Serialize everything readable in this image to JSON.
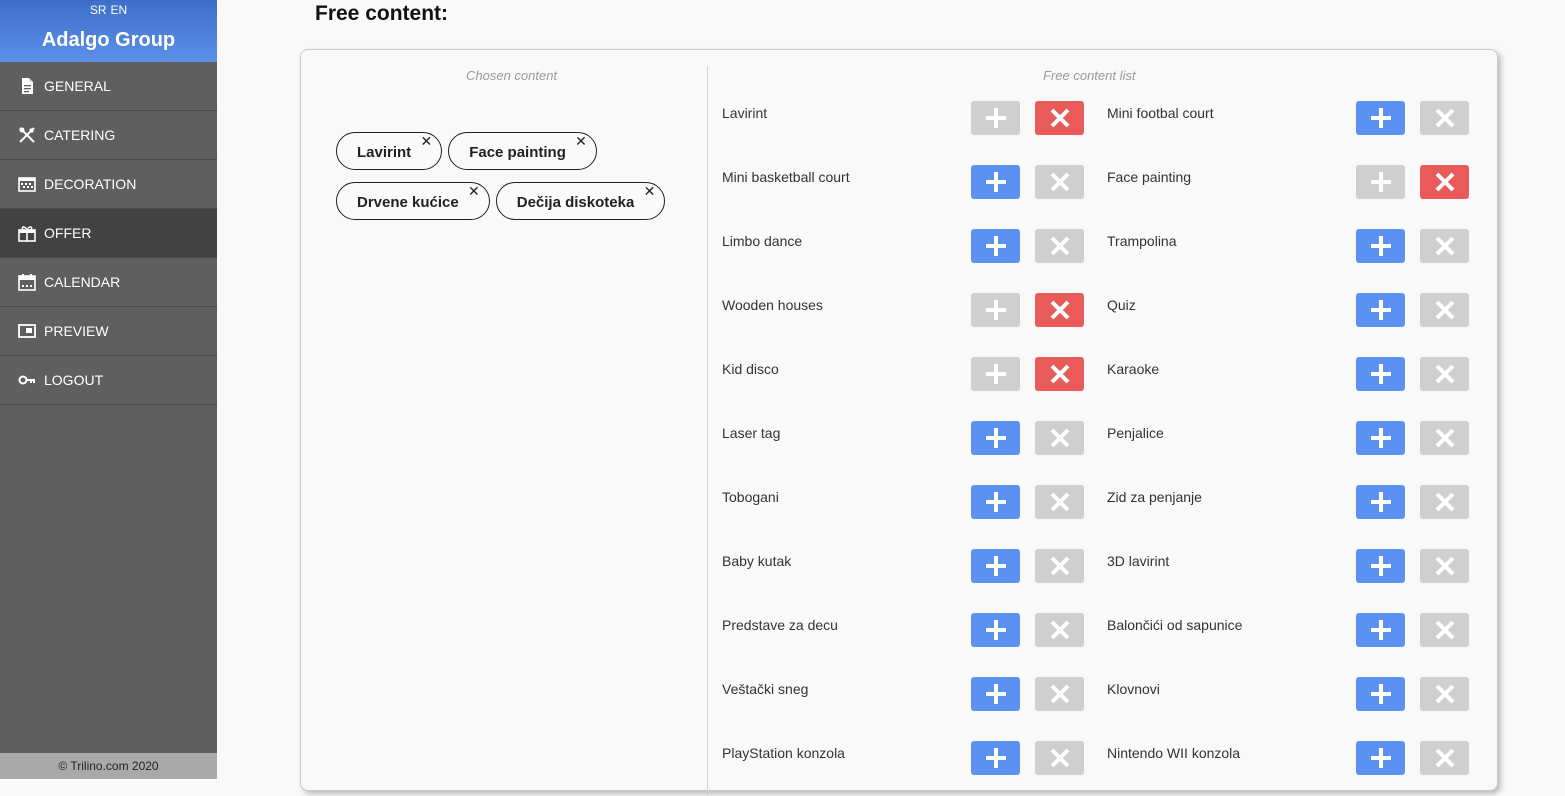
{
  "sidebar": {
    "lang": [
      "SR",
      "EN"
    ],
    "brand": "Adalgo Group",
    "items": [
      {
        "label": "GENERAL",
        "icon": "document-icon",
        "active": false
      },
      {
        "label": "CATERING",
        "icon": "fork-knife-icon",
        "active": false
      },
      {
        "label": "DECORATION",
        "icon": "grid-pattern-icon",
        "active": false
      },
      {
        "label": "OFFER",
        "icon": "gift-box-icon",
        "active": true
      },
      {
        "label": "CALENDAR",
        "icon": "calendar-icon",
        "active": false
      },
      {
        "label": "PREVIEW",
        "icon": "preview-window-icon",
        "active": false
      },
      {
        "label": "LOGOUT",
        "icon": "key-icon",
        "active": false
      }
    ],
    "footer": "© Trilino.com 2020"
  },
  "main": {
    "title": "Free content:",
    "chosen_title": "Chosen content",
    "free_title": "Free content list",
    "chosen": [
      "Lavirint",
      "Face painting",
      "Drvene kućice",
      "Dečija diskoteka"
    ],
    "left_list": [
      {
        "label": "Lavirint",
        "selected": true
      },
      {
        "label": "Mini basketball court",
        "selected": false
      },
      {
        "label": "Limbo dance",
        "selected": false
      },
      {
        "label": "Wooden houses",
        "selected": true
      },
      {
        "label": "Kid disco",
        "selected": true
      },
      {
        "label": "Laser tag",
        "selected": false
      },
      {
        "label": "Tobogani",
        "selected": false
      },
      {
        "label": "Baby kutak",
        "selected": false
      },
      {
        "label": "Predstave za decu",
        "selected": false
      },
      {
        "label": "Veštački sneg",
        "selected": false
      },
      {
        "label": "PlayStation konzola",
        "selected": false
      }
    ],
    "right_list": [
      {
        "label": "Mini footbal court",
        "selected": false
      },
      {
        "label": "Face painting",
        "selected": true
      },
      {
        "label": "Trampolina",
        "selected": false
      },
      {
        "label": "Quiz",
        "selected": false
      },
      {
        "label": "Karaoke",
        "selected": false
      },
      {
        "label": "Penjalice",
        "selected": false
      },
      {
        "label": "Zid za penjanje",
        "selected": false
      },
      {
        "label": "3D lavirint",
        "selected": false
      },
      {
        "label": "Balončići od sapunice",
        "selected": false
      },
      {
        "label": "Klovnovi",
        "selected": false
      },
      {
        "label": "Nintendo WII konzola",
        "selected": false
      }
    ],
    "colors": {
      "add": "#5b91f0",
      "remove": "#e95a5a",
      "disabled": "#cfcfcf"
    }
  }
}
